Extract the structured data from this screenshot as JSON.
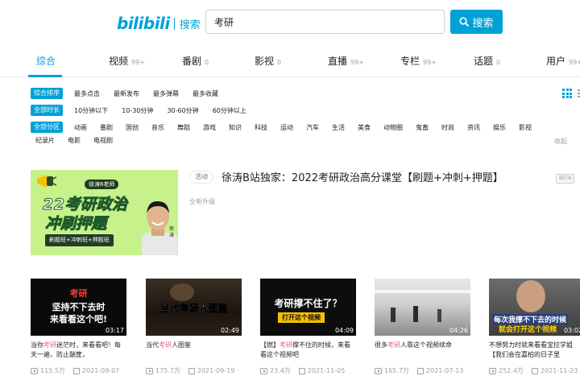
{
  "header": {
    "logo_text": "bilibili",
    "logo_sub": "搜索",
    "search_value": "考研",
    "search_button": "搜索"
  },
  "tabs": [
    {
      "label": "综合",
      "count": ""
    },
    {
      "label": "视频",
      "count": "99+"
    },
    {
      "label": "番剧",
      "count": "0"
    },
    {
      "label": "影视",
      "count": "0"
    },
    {
      "label": "直播",
      "count": "99+"
    },
    {
      "label": "专栏",
      "count": "99+"
    },
    {
      "label": "话题",
      "count": "0"
    },
    {
      "label": "用户",
      "count": "99+"
    }
  ],
  "filters": {
    "sort": {
      "badge": "综合排序",
      "items": [
        "最多点击",
        "最新发布",
        "最多弹幕",
        "最多收藏"
      ]
    },
    "duration": {
      "badge": "全部时长",
      "items": [
        "10分钟以下",
        "10-30分钟",
        "30-60分钟",
        "60分钟以上"
      ]
    },
    "zone": {
      "badge": "全部分区",
      "items": [
        "动画",
        "番剧",
        "国创",
        "音乐",
        "舞蹈",
        "游戏",
        "知识",
        "科技",
        "运动",
        "汽车",
        "生活",
        "美食",
        "动物圈",
        "鬼畜",
        "时尚",
        "资讯",
        "娱乐",
        "影视"
      ],
      "items2": [
        "纪录片",
        "电影",
        "电视剧"
      ]
    },
    "collapse": "收起"
  },
  "featured": {
    "badge": "活动",
    "title": "徐涛B站独家：2022考研政治高分课堂【刷题+冲刺+押题】",
    "subtitle": "全新升级",
    "beta": "BETA",
    "image": {
      "pill": "徐涛6老师",
      "line1": "22考研政治",
      "line2": "冲刷押题",
      "bar": "刷题班+冲刺班+押题班",
      "name": "徐涛"
    }
  },
  "videos": [
    {
      "thumb_l1": "考研",
      "thumb_l2": "坚持不下去时",
      "thumb_l3": "来看看这个吧!",
      "duration": "03:17",
      "title_pre": "当你",
      "title_hl": "考研",
      "title_post": "迷茫时，来看看吧！每天一遍，防止踹筐，",
      "plays": "115.5万",
      "date": "2021-09-07"
    },
    {
      "thumb_l1": "当代考研人图鉴",
      "duration": "02:49",
      "title_pre": "当代",
      "title_hl": "考研",
      "title_post": "人图鉴",
      "plays": "175.7万",
      "date": "2021-09-19"
    },
    {
      "thumb_l1": "考研撑不住了？",
      "thumb_l2": "打开这个视频",
      "duration": "04:09",
      "title_pre": "【燃】",
      "title_hl": "考研",
      "title_post": "撑不住的时候，来看看这个视频吧",
      "plays": "23.4万",
      "date": "2021-11-05"
    },
    {
      "duration": "04:26",
      "title_pre": "很多",
      "title_hl": "考研",
      "title_post": "人靠这个视频续命",
      "plays": "165.7万",
      "date": "2021-07-13"
    },
    {
      "thumb_l1": "每次我撑不下去的时候",
      "thumb_l2": "就会打开这个视频",
      "duration": "03:02",
      "title_pre": "",
      "title_hl": "",
      "title_post": "不想努力时就来看看宝拉学姐【我们会在嘉柏的日子里",
      "plays": "252.4万",
      "date": "2021-11-23"
    }
  ]
}
